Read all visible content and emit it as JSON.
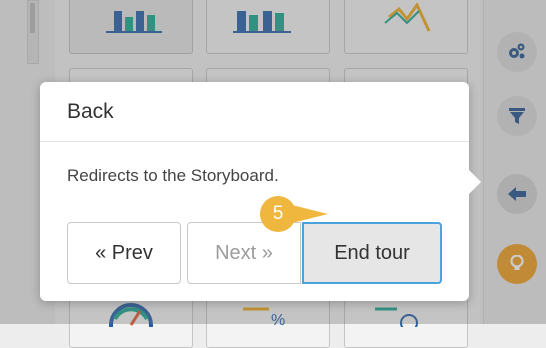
{
  "popover": {
    "title": "Back",
    "description": "Redirects to the Storyboard.",
    "prev_label": "« Prev",
    "next_label": "Next »",
    "end_label": "End tour"
  },
  "step": {
    "number": "5"
  },
  "toolbar": {
    "items": [
      {
        "icon": "gear-cluster-icon"
      },
      {
        "icon": "filter-icon"
      },
      {
        "icon": "arrow-left-icon"
      },
      {
        "icon": "bulb-icon"
      }
    ]
  },
  "colors": {
    "accent_orange": "#ef9a1a",
    "badge_yellow": "#f0b73e",
    "focus_blue": "#4aa3df",
    "chart_blue": "#1f5ea8",
    "chart_teal": "#15a58c"
  }
}
